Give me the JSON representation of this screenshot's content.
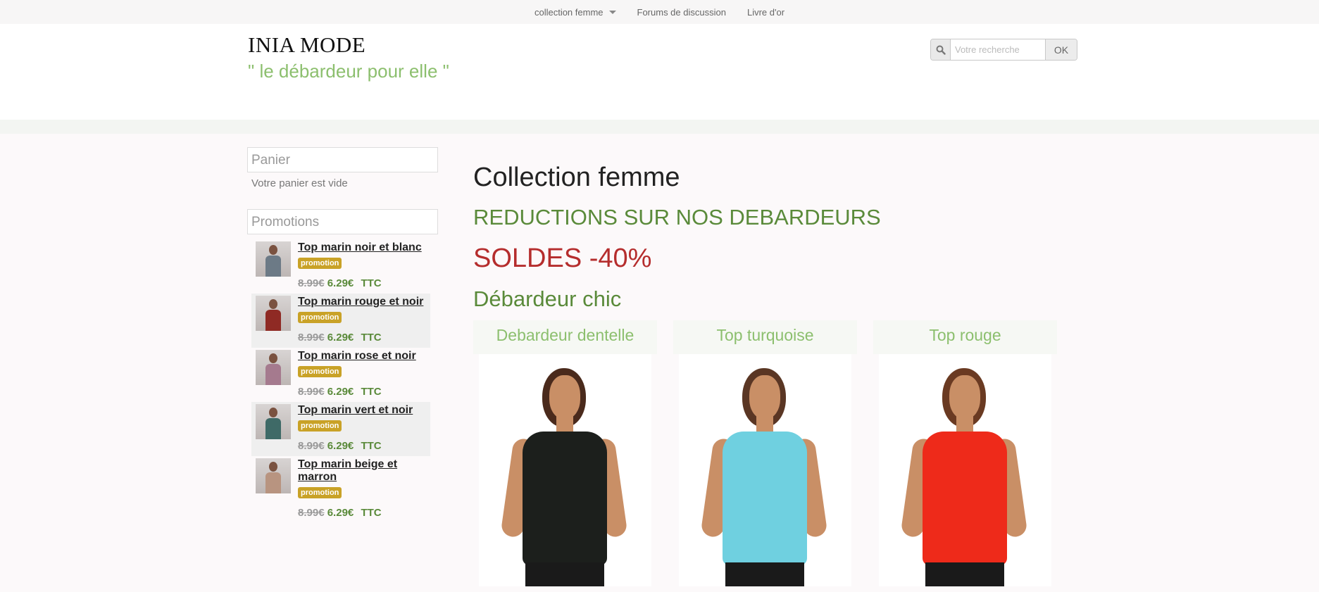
{
  "nav": {
    "items": [
      {
        "label": "collection femme",
        "dropdown": true
      },
      {
        "label": "Forums de discussion"
      },
      {
        "label": "Livre d'or"
      }
    ]
  },
  "header": {
    "title": "INIA MODE",
    "tagline": "\" le débardeur pour elle \"",
    "search": {
      "placeholder": "Votre recherche",
      "button": "OK",
      "icon": "search-icon"
    }
  },
  "sidebar": {
    "cart": {
      "title": "Panier",
      "empty_text": "Votre panier est vide"
    },
    "promotions": {
      "title": "Promotions",
      "items": [
        {
          "name": "Top marin noir et blanc",
          "badge": "promotion",
          "old_price": "8.99€",
          "new_price": "6.29€",
          "tax": "TTC",
          "color": "#6c7a86"
        },
        {
          "name": "Top marin rouge et noir",
          "badge": "promotion",
          "old_price": "8.99€",
          "new_price": "6.29€",
          "tax": "TTC",
          "color": "#8f2a24"
        },
        {
          "name": "Top marin rose et noir",
          "badge": "promotion",
          "old_price": "8.99€",
          "new_price": "6.29€",
          "tax": "TTC",
          "color": "#a57a8e"
        },
        {
          "name": "Top marin vert et noir",
          "badge": "promotion",
          "old_price": "8.99€",
          "new_price": "6.29€",
          "tax": "TTC",
          "color": "#3f6a67"
        },
        {
          "name": "Top marin beige et marron",
          "badge": "promotion",
          "old_price": "8.99€",
          "new_price": "6.29€",
          "tax": "TTC",
          "color": "#b89480"
        }
      ]
    }
  },
  "main": {
    "title": "Collection femme",
    "reductions": "REDUCTIONS SUR NOS DEBARDEURS",
    "soldes": "SOLDES -40%",
    "section": "Débardeur chic",
    "products": [
      {
        "name": "Debardeur dentelle",
        "top_color": "#1c1f1c",
        "hair_color": "#4a2a1c"
      },
      {
        "name": "Top turquoise",
        "top_color": "#6fd0e0",
        "hair_color": "#5a3624"
      },
      {
        "name": "Top rouge",
        "top_color": "#ee2a1a",
        "hair_color": "#6a3a22"
      }
    ]
  }
}
